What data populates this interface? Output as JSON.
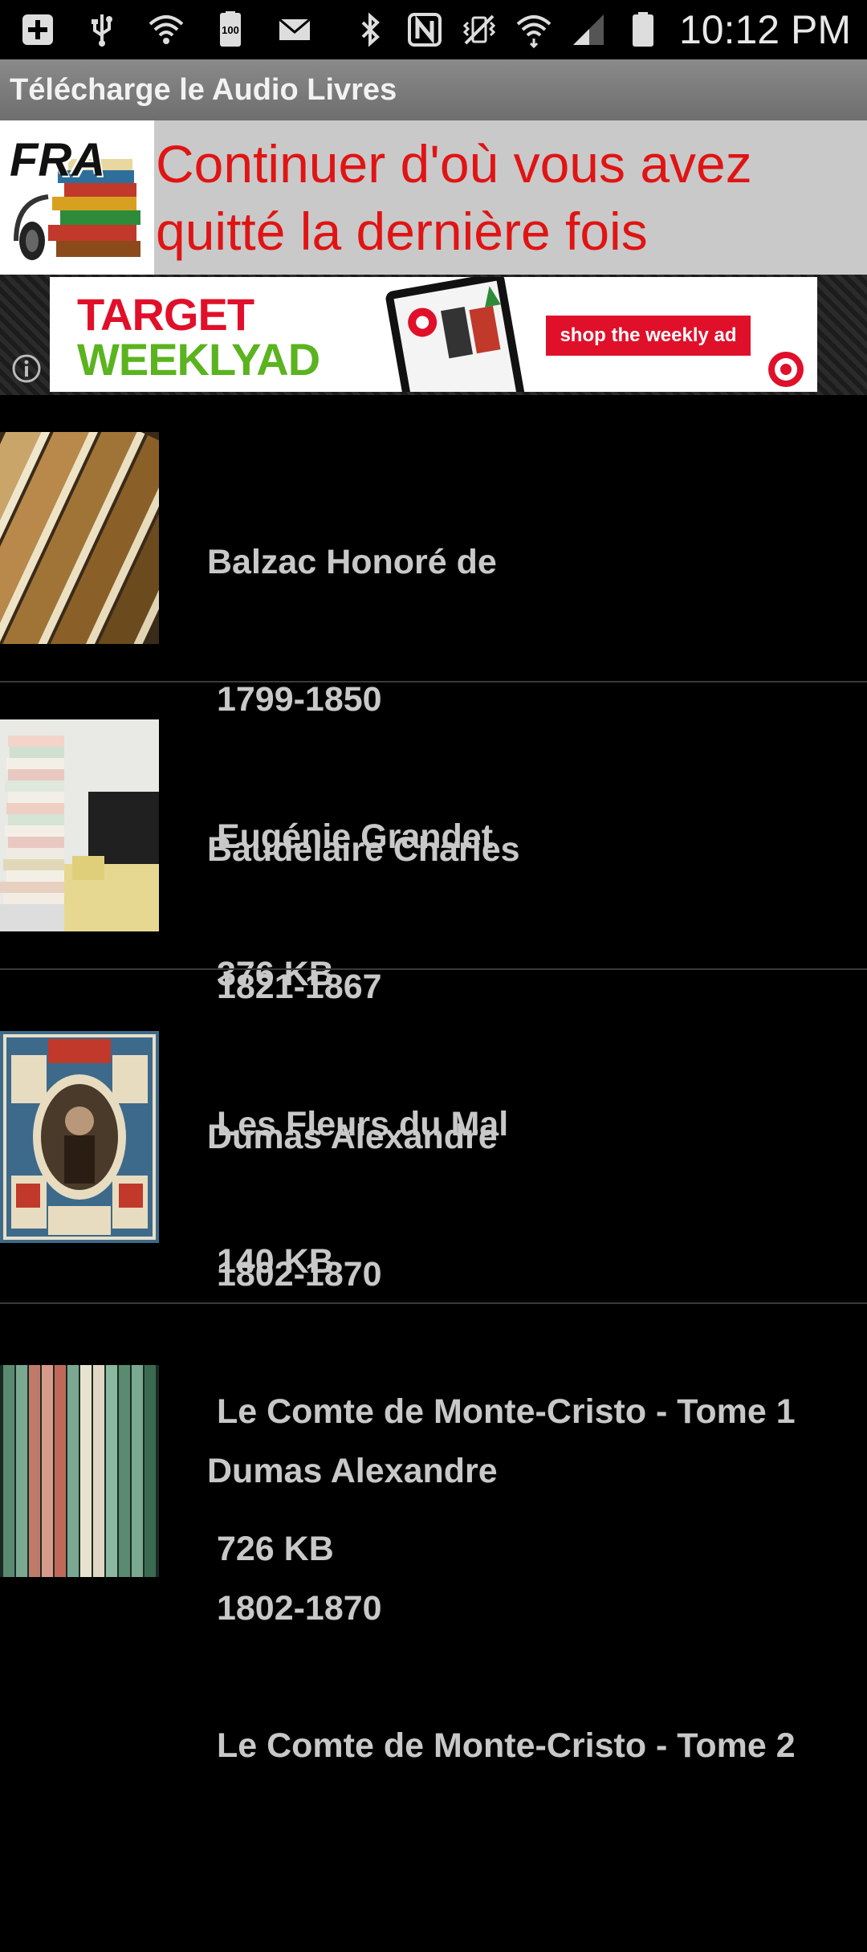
{
  "status_bar": {
    "time": "10:12 PM",
    "battery_text": "100",
    "left_icons": [
      "add-icon",
      "usb-icon",
      "wifi-icon",
      "battery-icon",
      "mail-icon"
    ],
    "right_icons": [
      "bluetooth-icon",
      "nfc-icon",
      "vibrate-icon",
      "wifi-icon",
      "signal-icon",
      "battery-icon"
    ]
  },
  "app": {
    "title": "Télécharge le Audio Livres"
  },
  "continue_banner": {
    "logo_text": "FRA",
    "text": "Continuer d'où vous avez quitté la dernière fois",
    "text_color": "#e01414"
  },
  "ad": {
    "headline_line1": "TARGET",
    "headline_line2": "WEEKLYAD",
    "cta": "shop the weekly ad",
    "brand_color": "#e0102a",
    "accent_color": "#5bb31f"
  },
  "books": [
    {
      "author": "Balzac Honoré de",
      "years": " 1799-1850",
      "title": " Eugénie Grandet",
      "size": " 376 KB"
    },
    {
      "author": "Baudelaire Charles",
      "years": " 1821-1867",
      "title": " Les Fleurs du Mal",
      "size": " 140 KB"
    },
    {
      "author": "Dumas Alexandre",
      "years": " 1802-1870",
      "title": " Le Comte de Monte-Cristo - Tome 1",
      "size": " 726 KB"
    },
    {
      "author": "Dumas Alexandre",
      "years": " 1802-1870",
      "title": " Le Comte de Monte-Cristo - Tome 2",
      "size": ""
    }
  ]
}
